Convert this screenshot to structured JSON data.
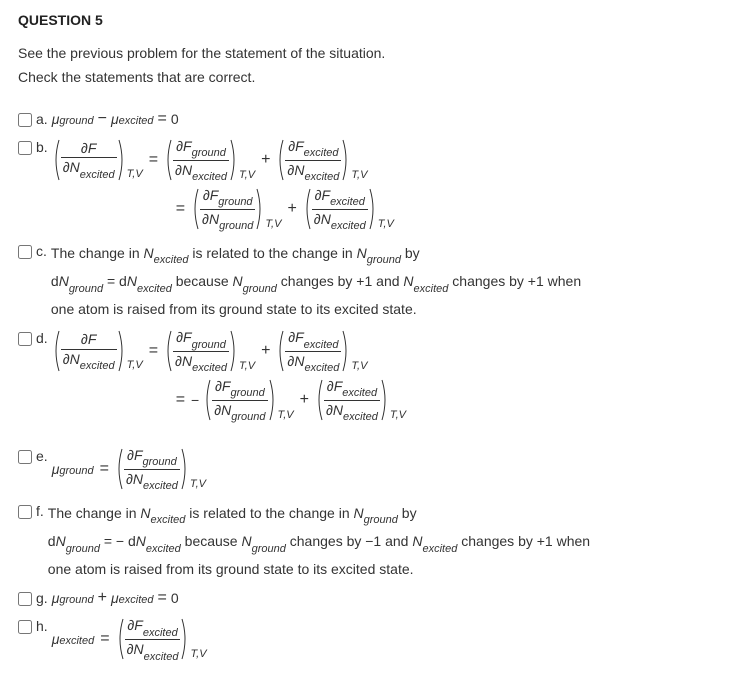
{
  "header": "QUESTION 5",
  "instructions": {
    "line1": "See the previous problem for the statement of the situation.",
    "line2": "Check the statements that are correct."
  },
  "labels": {
    "a": "a.",
    "b": "b.",
    "c": "c.",
    "d": "d.",
    "e": "e.",
    "f": "f.",
    "g": "g.",
    "h": "h."
  },
  "option_c": {
    "line1_pre": "The change in ",
    "line1_mid": " is related to the change in ",
    "line1_post": " by",
    "line2_pre": "d",
    "line2_eq": " = d",
    "line2_mid": " because ",
    "line2_mid2": " changes by +1 and ",
    "line2_end": " changes by +1 when",
    "line3": "one atom is raised from its ground state to its excited state."
  },
  "option_f": {
    "line1_pre": "The change in ",
    "line1_mid": " is related to the change in ",
    "line1_post": " by",
    "line2_pre": "d",
    "line2_eq": " = − d",
    "line2_mid": " because ",
    "line2_mid2": " changes by −1 and ",
    "line2_end": " changes by +1 when",
    "line3": "one atom is raised from its ground state to its excited state."
  },
  "sym": {
    "mu": "μ",
    "partial": "∂",
    "F": "F",
    "N": "N",
    "eq": "=",
    "minus": "−",
    "plus": "+",
    "zero": "0"
  },
  "subs": {
    "ground": "ground",
    "excited": "excited",
    "TV": "T,V"
  }
}
